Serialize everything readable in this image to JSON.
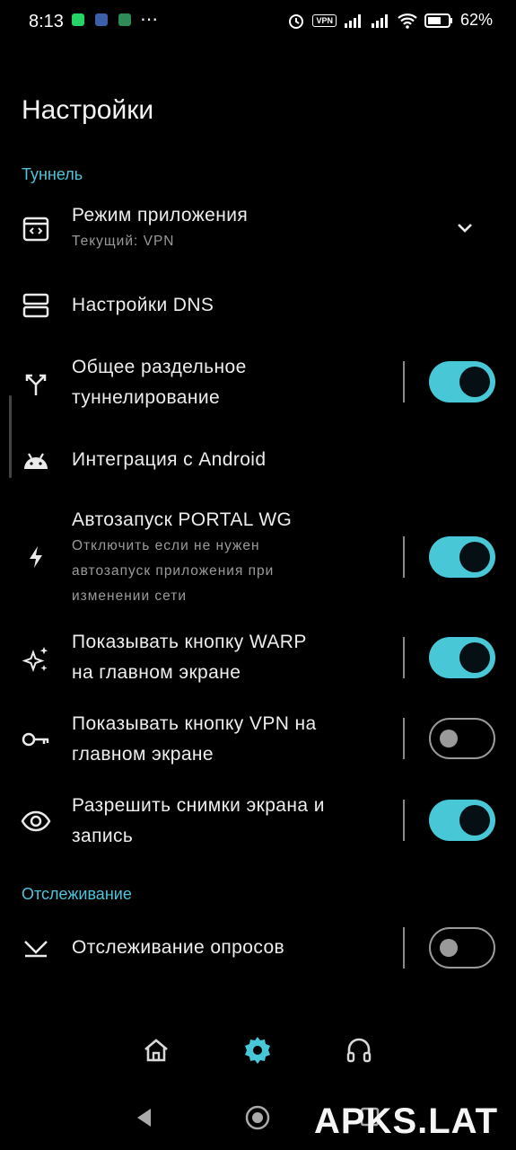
{
  "status_bar": {
    "time": "8:13",
    "battery": "62%",
    "vpn": "VPN",
    "more": "⋯"
  },
  "page_title": "Настройки",
  "sections": {
    "tunnel": "Туннель",
    "tracking": "Отслеживание"
  },
  "settings": {
    "app_mode": {
      "title": "Режим приложения",
      "subtitle": "Текущий: VPN"
    },
    "dns": {
      "title": "Настройки DNS"
    },
    "split_tunnel": {
      "title_line1": "Общее раздельное",
      "title_line2": "туннелирование",
      "enabled": true
    },
    "android": {
      "title": "Интеграция с Android"
    },
    "autostart": {
      "title": "Автозапуск PORTAL WG",
      "subtitle_line1": "Отключить если не нужен",
      "subtitle_line2": "автозапуск приложения при",
      "subtitle_line3": "изменении сети",
      "enabled": true
    },
    "warp_button": {
      "title_line1": "Показывать кнопку WARP",
      "title_line2": "на главном экране",
      "enabled": true
    },
    "vpn_button": {
      "title_line1": "Показывать кнопку VPN на",
      "title_line2": "главном экране",
      "enabled": false
    },
    "screenshots": {
      "title_line1": "Разрешить снимки экрана и",
      "title_line2": "запись",
      "enabled": true
    },
    "poll_tracking": {
      "title": "Отслеживание опросов",
      "enabled": false
    }
  },
  "bottom_nav": [
    "home-icon",
    "settings-icon",
    "support-headset-icon"
  ],
  "watermark": "APKS.LAT",
  "colors": {
    "accent": "#48c8d6",
    "section": "#4fc3d9",
    "background": "#000000"
  }
}
